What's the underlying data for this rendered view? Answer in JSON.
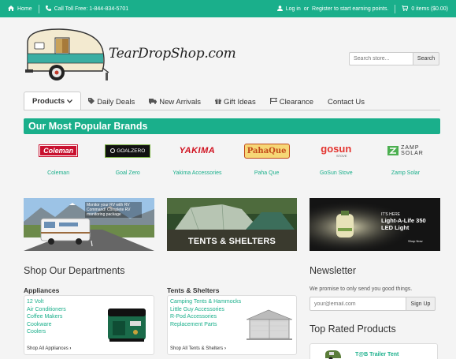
{
  "topbar": {
    "home": "Home",
    "phone": "Call Toll Free: 1-844-834-5701",
    "login": "Log in",
    "or": "or",
    "register": "Register to start earning points.",
    "cart": "0 items ($0.00)"
  },
  "header": {
    "logo_text": "TearDropShop.com",
    "search_placeholder": "Search store...",
    "search_button": "Search"
  },
  "nav": {
    "items": [
      {
        "label": "Products"
      },
      {
        "label": "Daily Deals"
      },
      {
        "label": "New Arrivals"
      },
      {
        "label": "Gift Ideas"
      },
      {
        "label": "Clearance"
      },
      {
        "label": "Contact Us"
      }
    ]
  },
  "brands": {
    "title": "Our Most Popular Brands",
    "items": [
      {
        "name": "Coleman",
        "logo": "Coleman"
      },
      {
        "name": "Goal Zero",
        "logo": "GOALZERO"
      },
      {
        "name": "Yakima Accessories",
        "logo": "YAKIMA"
      },
      {
        "name": "Paha Que",
        "logo": "PahaQue"
      },
      {
        "name": "GoSun Stove",
        "logo_a": "go",
        "logo_b": "sun",
        "logo_sub": "STOVE"
      },
      {
        "name": "Zamp Solar",
        "logo_a": "ZAMP",
        "logo_b": "SOLAR"
      }
    ]
  },
  "banners": {
    "rv_text": "Monitor your RV with RV Command! Complete RV monitoring package",
    "tents_text": "TENTS & SHELTERS",
    "light_line1": "IT'S HERE",
    "light_line2": "Light-A-Life 350",
    "light_line3": "LED Light",
    "light_cta": "Shop Now"
  },
  "departments": {
    "title": "Shop Our Departments",
    "appliances": {
      "title": "Appliances",
      "links": [
        "12 Volt",
        "Air Conditioners",
        "Coffee Makers",
        "Cookware",
        "Coolers"
      ],
      "all": "Shop All Appliances"
    },
    "tents": {
      "title": "Tents & Shelters",
      "links": [
        "Camping Tents & Hammocks",
        "Little Guy Accessories",
        "R-Pod Accessories",
        "Replacement Parts"
      ],
      "all": "Shop All Tents & Shelters"
    }
  },
  "newsletter": {
    "title": "Newsletter",
    "text": "We promise to only send you good things.",
    "placeholder": "your@email.com",
    "button": "Sign Up"
  },
  "top_rated": {
    "title": "Top Rated Products",
    "product": "T@B Trailer Tent"
  },
  "colors": {
    "accent": "#1aaf8b",
    "coleman": "#c8102e",
    "yakima": "#d0101e",
    "pahaque": "#c24a1a",
    "gosun": "#e3342f"
  }
}
